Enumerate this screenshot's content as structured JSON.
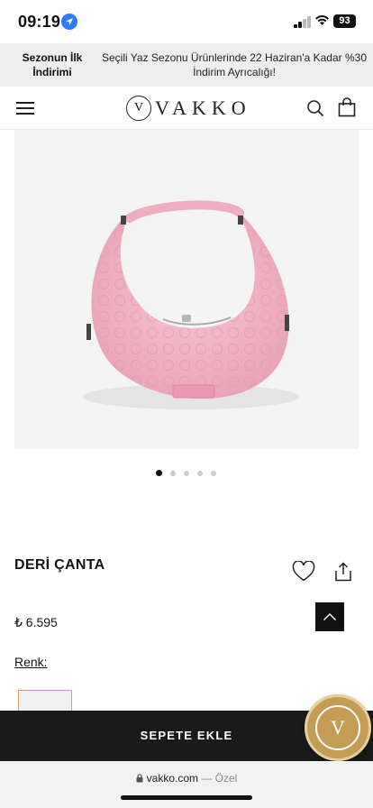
{
  "status_bar": {
    "time": "09:19",
    "battery": "93"
  },
  "promo": {
    "title": "Sezonun İlk İndirimi",
    "text": "Seçili Yaz Sezonu Ürünlerinde 22 Haziran'a Kadar %30 İndirim Ayrıcalığı!"
  },
  "header": {
    "logo_text": "VAKKO",
    "logo_mark": "V"
  },
  "carousel": {
    "total": 5,
    "active": 1
  },
  "product": {
    "name": "DERİ ÇANTA",
    "price": "₺ 6.595",
    "color_label": "Renk:",
    "image_color": "#f3b7c8"
  },
  "cart": {
    "add_label": "SEPETE EKLE"
  },
  "browser": {
    "domain": "vakko.com",
    "separator": " — ",
    "mode": "Özel"
  },
  "colors": {
    "accent_dark": "#1a1a1a",
    "gold": "#c49c56",
    "location_blue": "#2f7bf5"
  }
}
